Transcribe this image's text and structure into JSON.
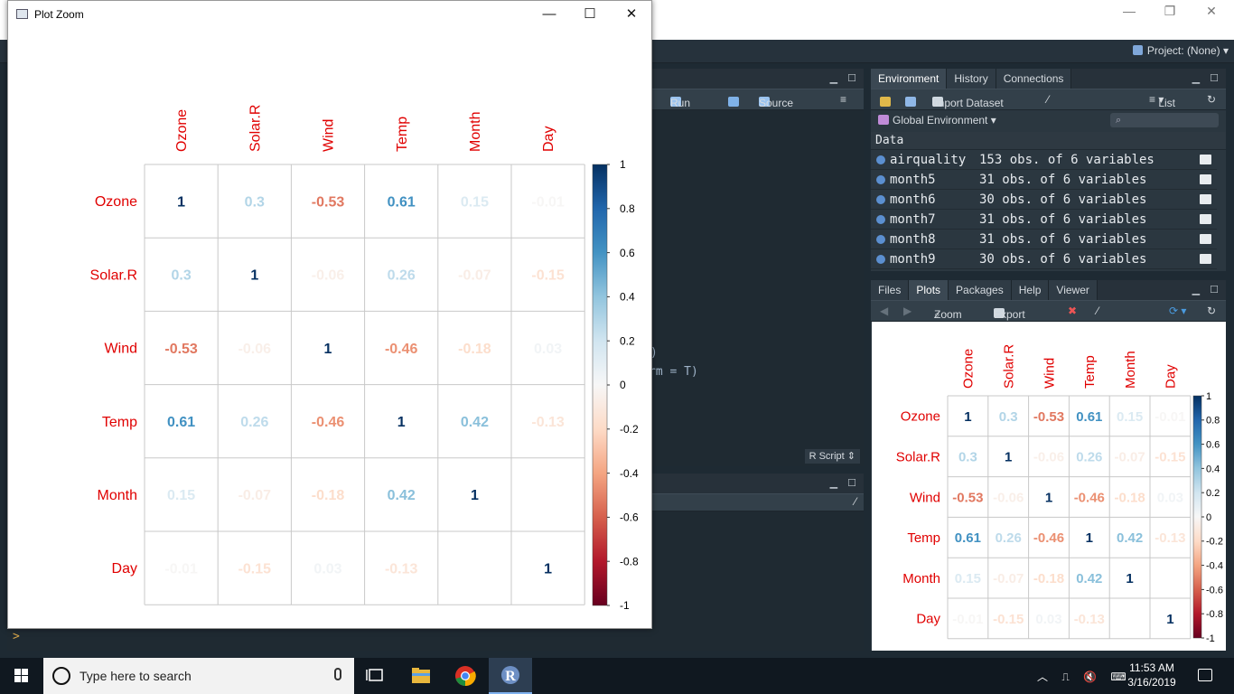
{
  "rstudio": {
    "project_label": "Project: (None)",
    "source": {
      "run_label": "Run",
      "source_label": "Source",
      "type_label": "R Script",
      "code_lines": [
        ")",
        "rm = T)"
      ]
    },
    "env_pane": {
      "tabs": [
        "Environment",
        "History",
        "Connections"
      ],
      "import_label": "Import Dataset",
      "view_label": "List",
      "scope_label": "Global Environment",
      "section_label": "Data",
      "rows": [
        {
          "name": "airquality",
          "value": "153 obs. of 6 variables"
        },
        {
          "name": "month5",
          "value": "31 obs. of 6 variables"
        },
        {
          "name": "month6",
          "value": "30 obs. of 6 variables"
        },
        {
          "name": "month7",
          "value": "31 obs. of 6 variables"
        },
        {
          "name": "month8",
          "value": "31 obs. of 6 variables"
        },
        {
          "name": "month9",
          "value": "30 obs. of 6 variables"
        }
      ]
    },
    "plots_pane": {
      "tabs": [
        "Files",
        "Plots",
        "Packages",
        "Help",
        "Viewer"
      ],
      "zoom_label": "Zoom",
      "export_label": "Export"
    },
    "console_prompt": ">"
  },
  "plot_zoom": {
    "title": "Plot Zoom",
    "minimize": "—",
    "maximize": "☐",
    "close": "✕"
  },
  "taskbar": {
    "search_placeholder": "Type here to search",
    "time": "11:53 AM",
    "date": "3/16/2019"
  },
  "colors": {
    "positive": "#053061",
    "negative": "#67001f",
    "label": "#e00000"
  },
  "chart_data": {
    "type": "heatmap",
    "variables": [
      "Ozone",
      "Solar.R",
      "Wind",
      "Temp",
      "Month",
      "Day"
    ],
    "values": [
      [
        1,
        0.3,
        -0.53,
        0.61,
        0.15,
        -0.01
      ],
      [
        0.3,
        1,
        -0.06,
        0.26,
        -0.07,
        -0.15
      ],
      [
        -0.53,
        -0.06,
        1,
        -0.46,
        -0.18,
        0.03
      ],
      [
        0.61,
        0.26,
        -0.46,
        1,
        0.42,
        -0.13
      ],
      [
        0.15,
        -0.07,
        -0.18,
        0.42,
        1,
        0
      ],
      [
        -0.01,
        -0.15,
        0.03,
        -0.13,
        0,
        1
      ]
    ],
    "labels": [
      [
        "1",
        "0.3",
        "-0.53",
        "0.61",
        "0.15",
        "-0.01"
      ],
      [
        "0.3",
        "1",
        "-0.06",
        "0.26",
        "-0.07",
        "-0.15"
      ],
      [
        "-0.53",
        "-0.06",
        "1",
        "-0.46",
        "-0.18",
        "0.03"
      ],
      [
        "0.61",
        "0.26",
        "-0.46",
        "1",
        "0.42",
        "-0.13"
      ],
      [
        "0.15",
        "-0.07",
        "-0.18",
        "0.42",
        "1",
        ""
      ],
      [
        "-0.01",
        "-0.15",
        "0.03",
        "-0.13",
        "",
        "1"
      ]
    ],
    "colorbar_ticks": [
      "1",
      "0.8",
      "0.6",
      "0.4",
      "0.2",
      "0",
      "-0.2",
      "-0.4",
      "-0.6",
      "-0.8",
      "-1"
    ],
    "range": [
      -1,
      1
    ],
    "grid": true,
    "legend_placement": "right"
  }
}
